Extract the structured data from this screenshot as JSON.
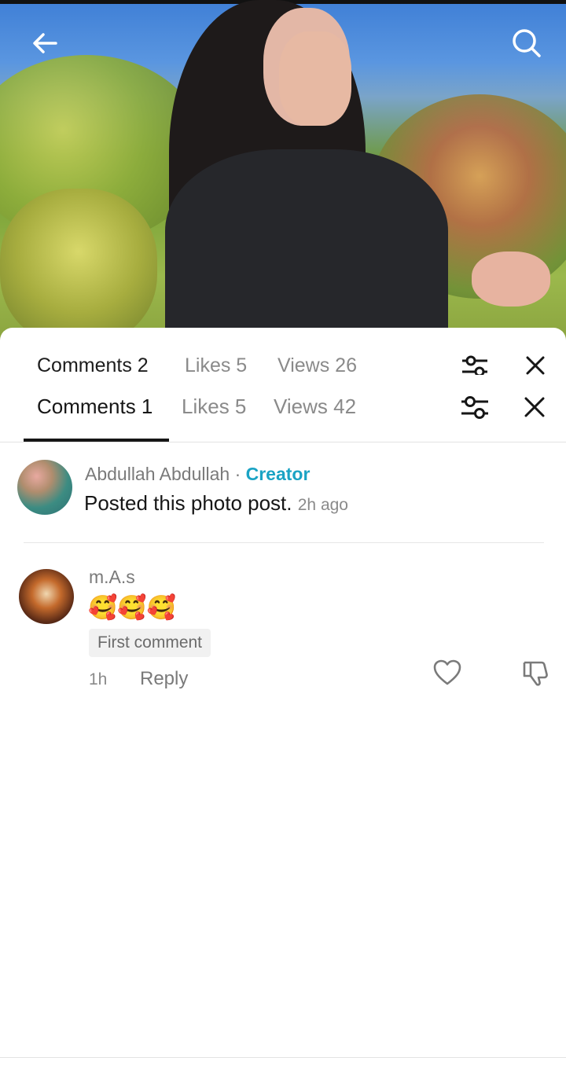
{
  "ghost_tabs": {
    "comments": "Comments 2",
    "likes": "Likes 5",
    "views": "Views 26"
  },
  "tabs": {
    "comments": "Comments 1",
    "likes": "Likes 5",
    "views": "Views 42"
  },
  "creator_post": {
    "author": "Abdullah Abdullah",
    "separator": "·",
    "role": "Creator",
    "text": "Posted this photo post.",
    "time": "2h ago"
  },
  "comment": {
    "author": "m.A.s",
    "text": "🥰🥰🥰",
    "badge": "First comment",
    "time": "1h",
    "reply_label": "Reply"
  },
  "colors": {
    "creator_accent": "#1aa3c4",
    "text": "#161616",
    "muted": "#8a8a8a"
  },
  "icons": [
    "back-arrow-icon",
    "search-icon",
    "filter-sliders-icon",
    "close-icon",
    "heart-icon",
    "dislike-icon"
  ]
}
